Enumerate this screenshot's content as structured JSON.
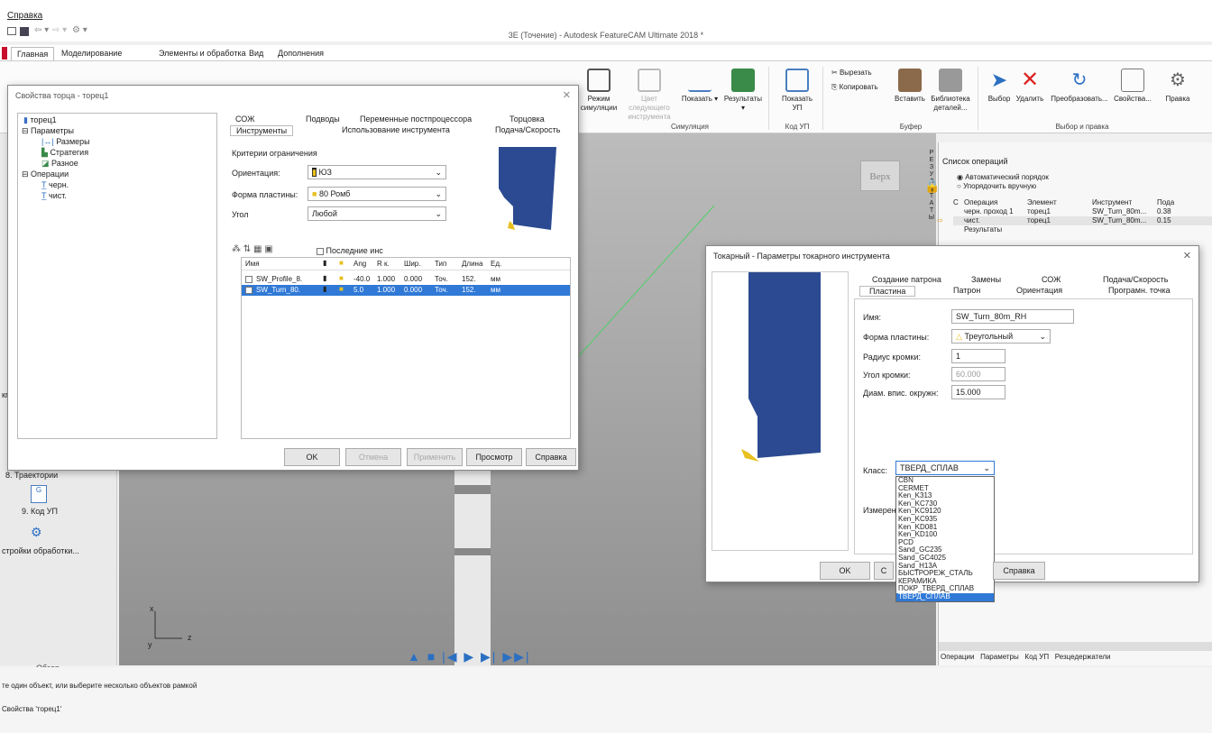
{
  "menu": {
    "help": "Справка"
  },
  "app": {
    "title": "3E (Точение) - Autodesk FeatureCAM Ultimate 2018 *"
  },
  "tabs": [
    "Главная",
    "Моделирование",
    "Элементы и обработка",
    "Вид",
    "Дополнения"
  ],
  "ribbon": {
    "sim": {
      "mode": "Режим\nсимуляции",
      "color": "Цвет следующего\nинструмента",
      "show": "Показать",
      "results": "Результаты",
      "group": "Симуляция"
    },
    "nc": {
      "show": "Показать\nУП",
      "group": "Код УП"
    },
    "buffer": {
      "cut": "Вырезать",
      "copy": "Копировать",
      "paste": "Вставить",
      "library": "Библиотека\nдеталей...",
      "group": "Буфер"
    },
    "edit": {
      "select": "Выбор",
      "delete": "Удалить",
      "transform": "Преобразовать...",
      "props": "Свойства...",
      "edit": "Правка",
      "group": "Выбор и правка"
    },
    "fragment": "Правка"
  },
  "left": {
    "trajectories": "8. Траектории",
    "nccode": "9. Код УП",
    "settings": "стройки обработки...",
    "overview": "Обзор",
    "cut_char": "кп"
  },
  "viewport": {
    "top_label": "Верх",
    "axis_x": "x",
    "axis_y": "y",
    "axis_z": "z"
  },
  "ops": {
    "title": "Список операций",
    "auto": "Автоматический порядок",
    "manual": "Упорядочить вручную",
    "headers": [
      "С",
      "Операция",
      "Элемент",
      "Инструмент",
      "Пода"
    ],
    "rows": [
      [
        "",
        "черн. проход 1",
        "торец1",
        "SW_Turn_80m...",
        "0.38"
      ],
      [
        "",
        "чист.",
        "торец1",
        "SW_Turn_80m...",
        "0.15"
      ]
    ],
    "results": "Результаты",
    "side_letters": "Р\nЕ\nЗ\nУ\nЛ\nЬ\nТ\nА\nТ\nЫ",
    "bottom_tabs": [
      "Операции",
      "Параметры",
      "Код УП",
      "Резцедержатели"
    ]
  },
  "status": {
    "line1": "те один объект, или выберите несколько объектов рамкой",
    "line2": "Свойства 'торец1'"
  },
  "face_dialog": {
    "title": "Свойства торца - торец1",
    "tree": [
      "торец1",
      "Параметры",
      "Размеры",
      "Стратегия",
      "Разное",
      "Операции",
      "черн.",
      "чист."
    ],
    "tabs_top": [
      "СОЖ",
      "Подводы",
      "Переменные постпроцессора",
      "Торцовка"
    ],
    "tabs_bottom": [
      "Инструменты",
      "Использование инструмента",
      "Подача/Скорость"
    ],
    "criteria": "Критерии ограничения",
    "orientation_label": "Ориентация:",
    "orientation": "ЮЗ",
    "shape_label": "Форма пластины:",
    "shape": "80 Ромб",
    "angle_label": "Угол",
    "angle": "Любой",
    "last_tools": "Последние инс",
    "cols": [
      "Имя",
      "",
      "",
      "Ang",
      "R к.",
      "Шир.",
      "Тип",
      "Длина",
      "Ед."
    ],
    "tools": [
      [
        "SW_Profile_8.",
        "-40.0",
        "1.000",
        "0.000",
        "Точ.",
        "152.",
        "мм"
      ],
      [
        "SW_Turn_80.",
        "5.0",
        "1.000",
        "0.000",
        "Точ.",
        "152.",
        "мм"
      ]
    ],
    "btn_ok": "OK",
    "btn_cancel": "Отмена",
    "btn_apply": "Применить",
    "btn_preview": "Просмотр",
    "btn_help": "Справка"
  },
  "tool_dialog": {
    "title": "Токарный - Параметры токарного инструмента",
    "tabs_top": [
      "Создание патрона",
      "Замены",
      "СОЖ",
      "Подача/Скорость"
    ],
    "tabs_bottom": [
      "Пластина",
      "Патрон",
      "Ориентация",
      "Програмн. точка"
    ],
    "name_label": "Имя:",
    "name": "SW_Turn_80m_RH",
    "shape_label": "Форма пластины:",
    "shape": "Треугольный",
    "radius_label": "Радиус кромки:",
    "radius": "1",
    "angle_label": "Угол кромки:",
    "angle": "60.000",
    "diam_label": "Диам. впис. окружн:",
    "diam": "15.000",
    "class_label": "Класс:",
    "class_value": "ТВЕРД_СПЛАВ",
    "measure_label": "Измерени",
    "class_options": [
      "CBN",
      "CERMET",
      "Ken_K313",
      "Ken_KC730",
      "Ken_KC9120",
      "Ken_KC935",
      "Ken_KD081",
      "Ken_KD100",
      "PCD",
      "Sand_GC235",
      "Sand_GC4025",
      "Sand_H13A",
      "БЫСТРОРЕЖ_СТАЛЬ",
      "КЕРАМИКА",
      "ПОКР_ТВЕРД_СПЛАВ",
      "ТВЕРД_СПЛАВ"
    ],
    "btn_ok": "OK",
    "btn_c": "C",
    "btn_help": "Справка"
  },
  "colors": {
    "tool_blue": "#2b4a91",
    "selection": "#3079d6",
    "insert_yellow": "#e8c020"
  }
}
